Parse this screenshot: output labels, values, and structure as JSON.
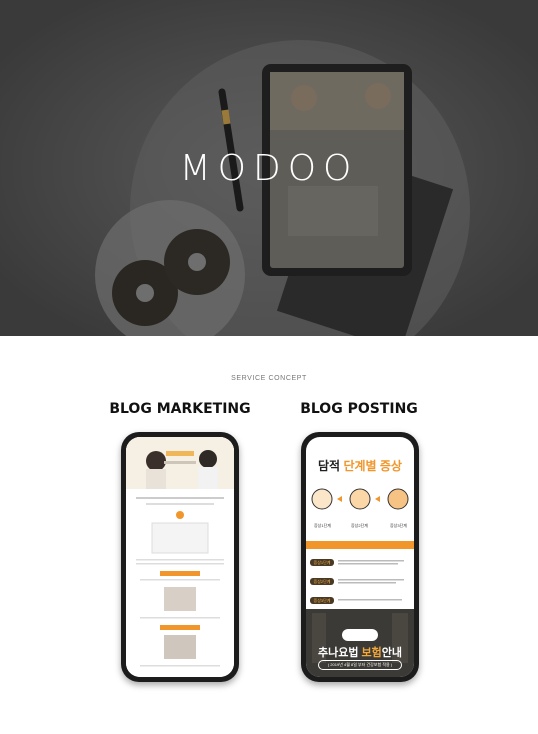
{
  "hero": {
    "title": "MODOO"
  },
  "section": {
    "label": "SERVICE CONCEPT"
  },
  "columns": {
    "marketing": {
      "title": "BLOG MARKETING"
    },
    "posting": {
      "title": "BLOG POSTING"
    }
  },
  "posting_phone": {
    "header_title_pre": "담적",
    "header_title_accent": "단계별 증상",
    "step1": "증상1단계",
    "step2": "증상2단계",
    "step3": "증상3단계",
    "bottom_title_pre": "추나요법",
    "bottom_title_accent": "보험",
    "bottom_title_post": "안내",
    "bottom_sub": "( 2019년 4월 8일 부터 건강보험 적용 )"
  },
  "colors": {
    "accent": "#f0962b",
    "hero_bg": "#3e3e3e",
    "phone_frame": "#1c1c1c"
  }
}
